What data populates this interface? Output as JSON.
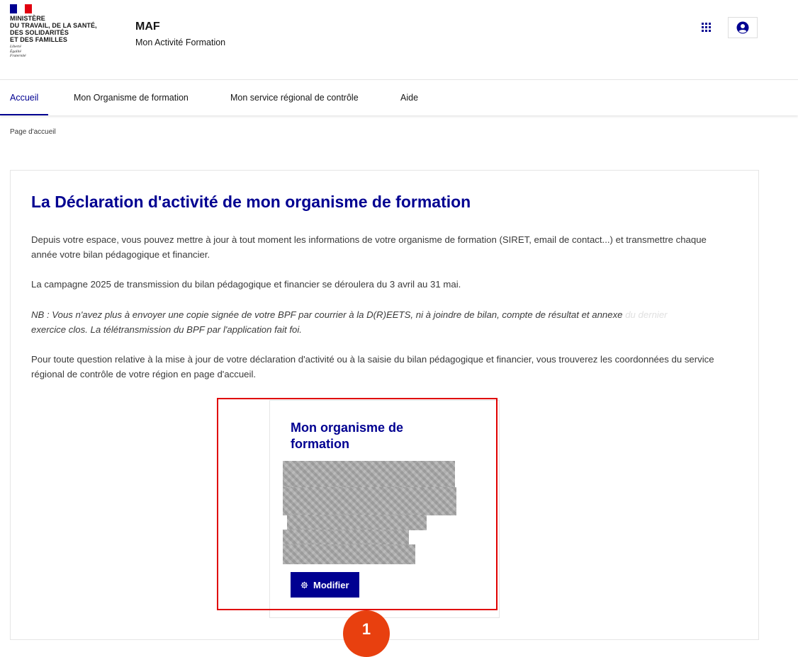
{
  "header": {
    "ministry_name": "MINISTÈRE\nDU TRAVAIL, DE LA SANTÉ,\nDES SOLIDARITÉS\nET DES FAMILLES",
    "devise": "Liberté\nÉgalité\nFraternité",
    "service_title": "MAF",
    "service_tagline": "Mon Activité Formation",
    "flag_colors": [
      "#000091",
      "#ffffff",
      "#e1000f"
    ],
    "icons": {
      "apps": "grid-apps-icon",
      "account": "user-account-icon"
    }
  },
  "nav": {
    "items": [
      {
        "label": "Accueil",
        "active": true
      },
      {
        "label": "Mon Organisme de formation",
        "active": false
      },
      {
        "label": "Mon service régional de contrôle",
        "active": false
      },
      {
        "label": "Aide",
        "active": false
      }
    ]
  },
  "breadcrumb": "Page d'accueil",
  "main": {
    "title": "La Déclaration d'activité de mon organisme de formation",
    "paragraphs": [
      "Depuis votre espace, vous pouvez mettre à jour à tout moment les informations de votre organisme de formation (SIRET, email de contact...) et transmettre chaque année votre bilan pédagogique et financier.",
      "La campagne 2025 de transmission du bilan pédagogique et financier se déroulera du 3 avril au 31 mai.",
      "NB : Vous n'avez plus à envoyer une copie signée de votre BPF par courrier à la D(R)EETS, ni à joindre de bilan, compte de résultat et annexe",
      "du dernier",
      "exercice clos. La télétransmission du BPF par l'application fait foi.",
      "Pour toute question relative à la mise à jour de votre déclaration d'activité ou à la saisie du bilan pédagogique et financier, vous trouverez les coordonnées du service régional de contrôle de votre région en page d'accueil."
    ]
  },
  "tile": {
    "title": "Mon organisme de formation",
    "modify_label": "Modifier",
    "modify_icon": "gear-icon"
  },
  "annotation": {
    "badge_number": "1",
    "highlight_color": "#e00000",
    "badge_color": "#e8400f"
  },
  "colors": {
    "accent": "#000091",
    "text": "#3a3a3a"
  }
}
